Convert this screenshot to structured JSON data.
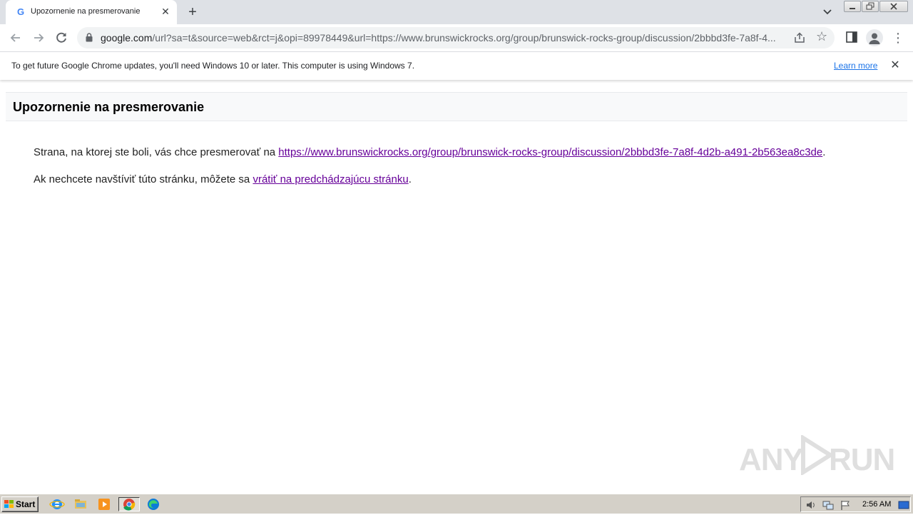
{
  "browser": {
    "tab": {
      "title": "Upozornenie na presmerovanie",
      "favicon": "G"
    },
    "new_tab_label": "+",
    "address": {
      "host": "google.com",
      "path": "/url?sa=t&source=web&rct=j&opi=89978449&url=https://www.brunswickrocks.org/group/brunswick-rocks-group/discussion/2bbbd3fe-7a8f-4..."
    },
    "infobar": {
      "message": "To get future Google Chrome updates, you'll need Windows 10 or later. This computer is using Windows 7.",
      "link": "Learn more"
    }
  },
  "page": {
    "title": "Upozornenie na presmerovanie",
    "redirect_prefix": "Strana, na ktorej ste boli, vás chce presmerovať na ",
    "redirect_url": "https://www.brunswickrocks.org/group/brunswick-rocks-group/discussion/2bbbd3fe-7a8f-4d2b-a491-2b563ea8c3de",
    "redirect_suffix": ".",
    "back_prefix": "Ak nechcete navštíviť túto stránku, môžete sa ",
    "back_link": "vrátiť na predchádzajúcu stránku",
    "back_suffix": "."
  },
  "watermark": {
    "left": "ANY",
    "right": "RUN"
  },
  "taskbar": {
    "start_label": "Start",
    "clock": "2:56 AM",
    "pinned": [
      "internet-explorer-icon",
      "file-explorer-icon",
      "media-player-icon",
      "chrome-icon",
      "edge-icon"
    ]
  },
  "colors": {
    "link_visited": "#660099",
    "link_blue": "#1a73e8",
    "tabstrip": "#dee1e6",
    "taskbar": "#d4d0c8"
  }
}
